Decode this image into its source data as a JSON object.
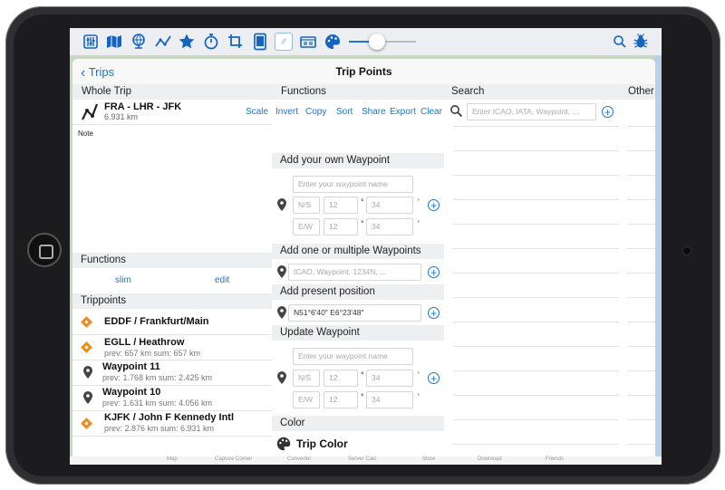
{
  "toolbar": {
    "icons": [
      "mixer-icon",
      "map-icon",
      "globe-icon",
      "route-icon",
      "star-icon",
      "stopwatch-icon",
      "crop-icon",
      "tablet-icon",
      "compass-icon",
      "cards-icon",
      "palette-icon",
      "search-icon",
      "bug-icon"
    ],
    "slider_value": 0.42,
    "accent": "#1565c0"
  },
  "nav": {
    "back_label": "Trips",
    "title": "Trip Points"
  },
  "columns": {
    "whole_trip": "Whole Trip",
    "functions": "Functions",
    "search": "Search",
    "other": "Other"
  },
  "trip": {
    "name": "FRA - LHR - JFK",
    "distance": "6.931 km",
    "actions": [
      "Scale",
      "Invert",
      "Copy",
      "Sort",
      "Share",
      "Export",
      "Clear"
    ],
    "note_label": "Note"
  },
  "left_functions": {
    "header": "Functions",
    "slim": "slim",
    "edit": "edit"
  },
  "trippoints": {
    "header": "Trippoints",
    "items": [
      {
        "icon": "airport-icon",
        "title": "EDDF / Frankfurt/Main",
        "sub": ""
      },
      {
        "icon": "airport-icon",
        "title": "EGLL / Heathrow",
        "sub": "prev: 657 km sum: 657 km"
      },
      {
        "icon": "pin-icon",
        "title": "Waypoint 11",
        "sub": "prev: 1.768 km sum: 2.425 km"
      },
      {
        "icon": "pin-icon",
        "title": "Waypoint 10",
        "sub": "prev: 1.631 km sum: 4.056 km"
      },
      {
        "icon": "airport-icon",
        "title": "KJFK / John F Kennedy Intl",
        "sub": "prev: 2.876 km sum: 6.931 km"
      }
    ]
  },
  "add_own": {
    "header": "Add your own Waypoint",
    "name_placeholder": "Enter your waypoint name",
    "ns": "N/S",
    "ns_deg": "12",
    "ns_min": "34",
    "ew": "E/W",
    "ew_deg": "12",
    "ew_min": "34",
    "deg_symbol": "°",
    "min_symbol": "'"
  },
  "add_multiple": {
    "header": "Add one or multiple Waypoints",
    "placeholder": "ICAO, Waypoint, 1234N, ..."
  },
  "present": {
    "header": "Add present position",
    "value": "N51°6'40\"   E6°23'48\""
  },
  "update": {
    "header": "Update Waypoint",
    "name_placeholder": "Enter your waypoint name",
    "ns": "N/S",
    "ns_deg": "12",
    "ns_min": "34",
    "ew": "E/W",
    "ew_deg": "12",
    "ew_min": "34"
  },
  "color": {
    "header": "Color",
    "label": "Trip Color"
  },
  "search": {
    "placeholder": "Enter ICAO, IATA, Waypoint, ..."
  },
  "bottom_tabs": [
    "Map",
    "Capture Corner",
    "Converter",
    "Server Calc",
    "Store",
    "Download",
    "Friends"
  ]
}
